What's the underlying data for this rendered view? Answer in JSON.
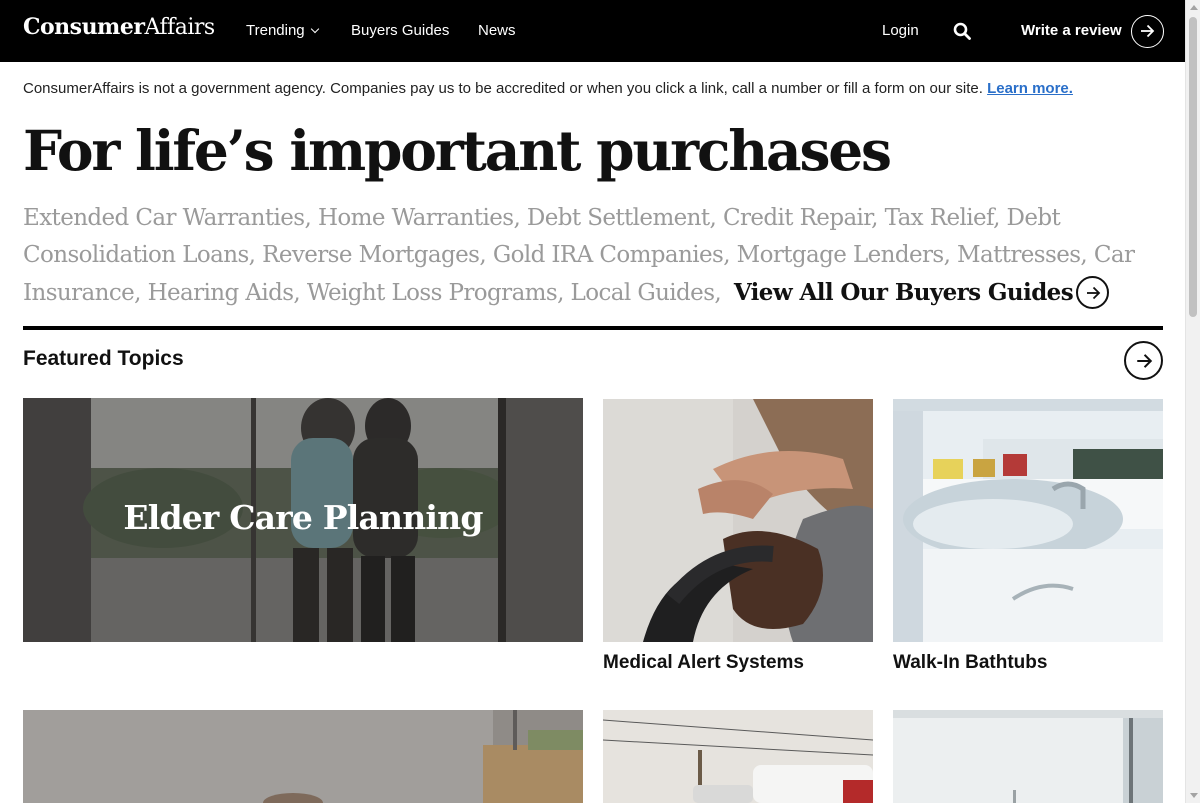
{
  "nav": {
    "logo_bold": "Consumer",
    "logo_thin": "Affairs",
    "trending": "Trending",
    "buyers_guides": "Buyers Guides",
    "news": "News",
    "login": "Login",
    "write_review": "Write a review"
  },
  "disclaimer": {
    "text": "ConsumerAffairs is not a government agency. Companies pay us to be accredited or when you click a link, call a number or fill a form on our site. ",
    "link": "Learn more."
  },
  "hero": {
    "title": "For life’s important purchases",
    "guides": [
      "Extended Car Warranties,",
      "Home Warranties,",
      "Debt Settlement,",
      "Credit Repair,",
      "Tax Relief,",
      "Debt Consolidation Loans,",
      "Reverse Mortgages,",
      "Gold IRA Companies,",
      "Mortgage Lenders,",
      "Mattresses,",
      "Car Insurance,",
      "Hearing Aids,",
      "Weight Loss Programs,",
      "Local Guides,"
    ],
    "view_all": "View All Our Buyers Guides"
  },
  "featured": {
    "title": "Featured Topics",
    "cards": [
      {
        "label": "Elder Care Planning"
      },
      {
        "label": "Medical Alert Systems"
      },
      {
        "label": "Walk-In Bathtubs"
      }
    ]
  },
  "colors": {
    "nav_bg": "#000000",
    "link": "#2a6fc9",
    "muted_guides": "#9a9a9a"
  }
}
